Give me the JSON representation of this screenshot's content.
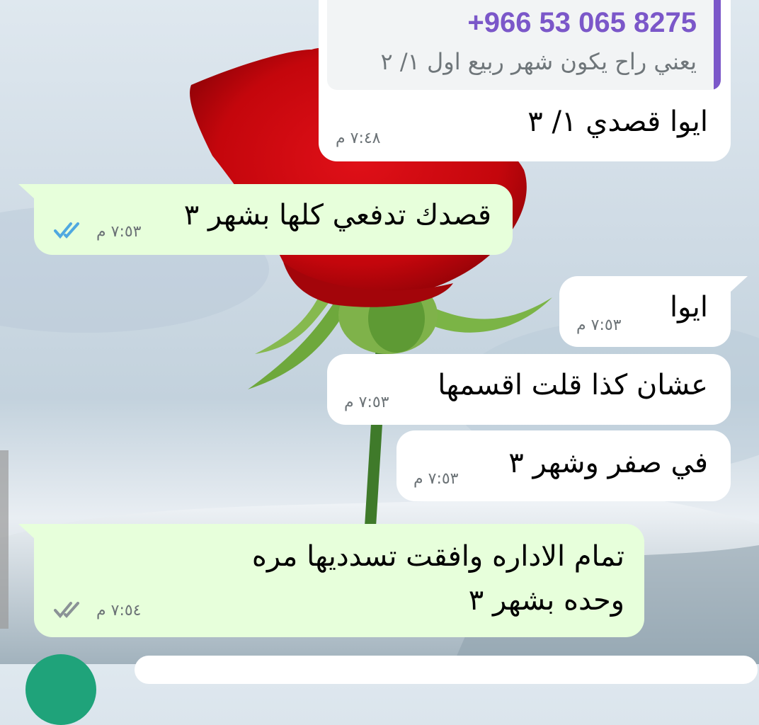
{
  "chat": {
    "quoted": {
      "sender": "+966 53 065 8275",
      "text": "يعني راح يكون شهر ربيع اول ١/ ٢"
    },
    "messages": [
      {
        "id": "m1",
        "direction": "incoming",
        "text": "ايوا قصدي ١/ ٣",
        "time": "٧:٤٨ م"
      },
      {
        "id": "m2",
        "direction": "outgoing",
        "text": "قصدك تدفعي كلها بشهر ٣",
        "time": "٧:٥٣ م",
        "status": "read"
      },
      {
        "id": "m3",
        "direction": "incoming",
        "text": "ايوا",
        "time": "٧:٥٣ م"
      },
      {
        "id": "m4",
        "direction": "incoming",
        "text": "عشان كذا قلت اقسمها",
        "time": "٧:٥٣ م"
      },
      {
        "id": "m5",
        "direction": "incoming",
        "text": "في صفر وشهر ٣",
        "time": "٧:٥٣ م"
      },
      {
        "id": "m6",
        "direction": "outgoing",
        "text_line1": "تمام الاداره وافقت تسدديها مره",
        "text_line2": "وحده بشهر ٣",
        "time": "٧:٥٤ م",
        "status": "sent"
      }
    ]
  },
  "colors": {
    "incoming_bubble": "#ffffff",
    "outgoing_bubble": "#e7ffdb",
    "quote_accent": "#7b57c9",
    "read_ticks": "#4fa8e0",
    "sent_ticks": "#8a9296"
  },
  "icons": {
    "read_status": "double-check-icon",
    "sent_status": "double-check-icon"
  }
}
